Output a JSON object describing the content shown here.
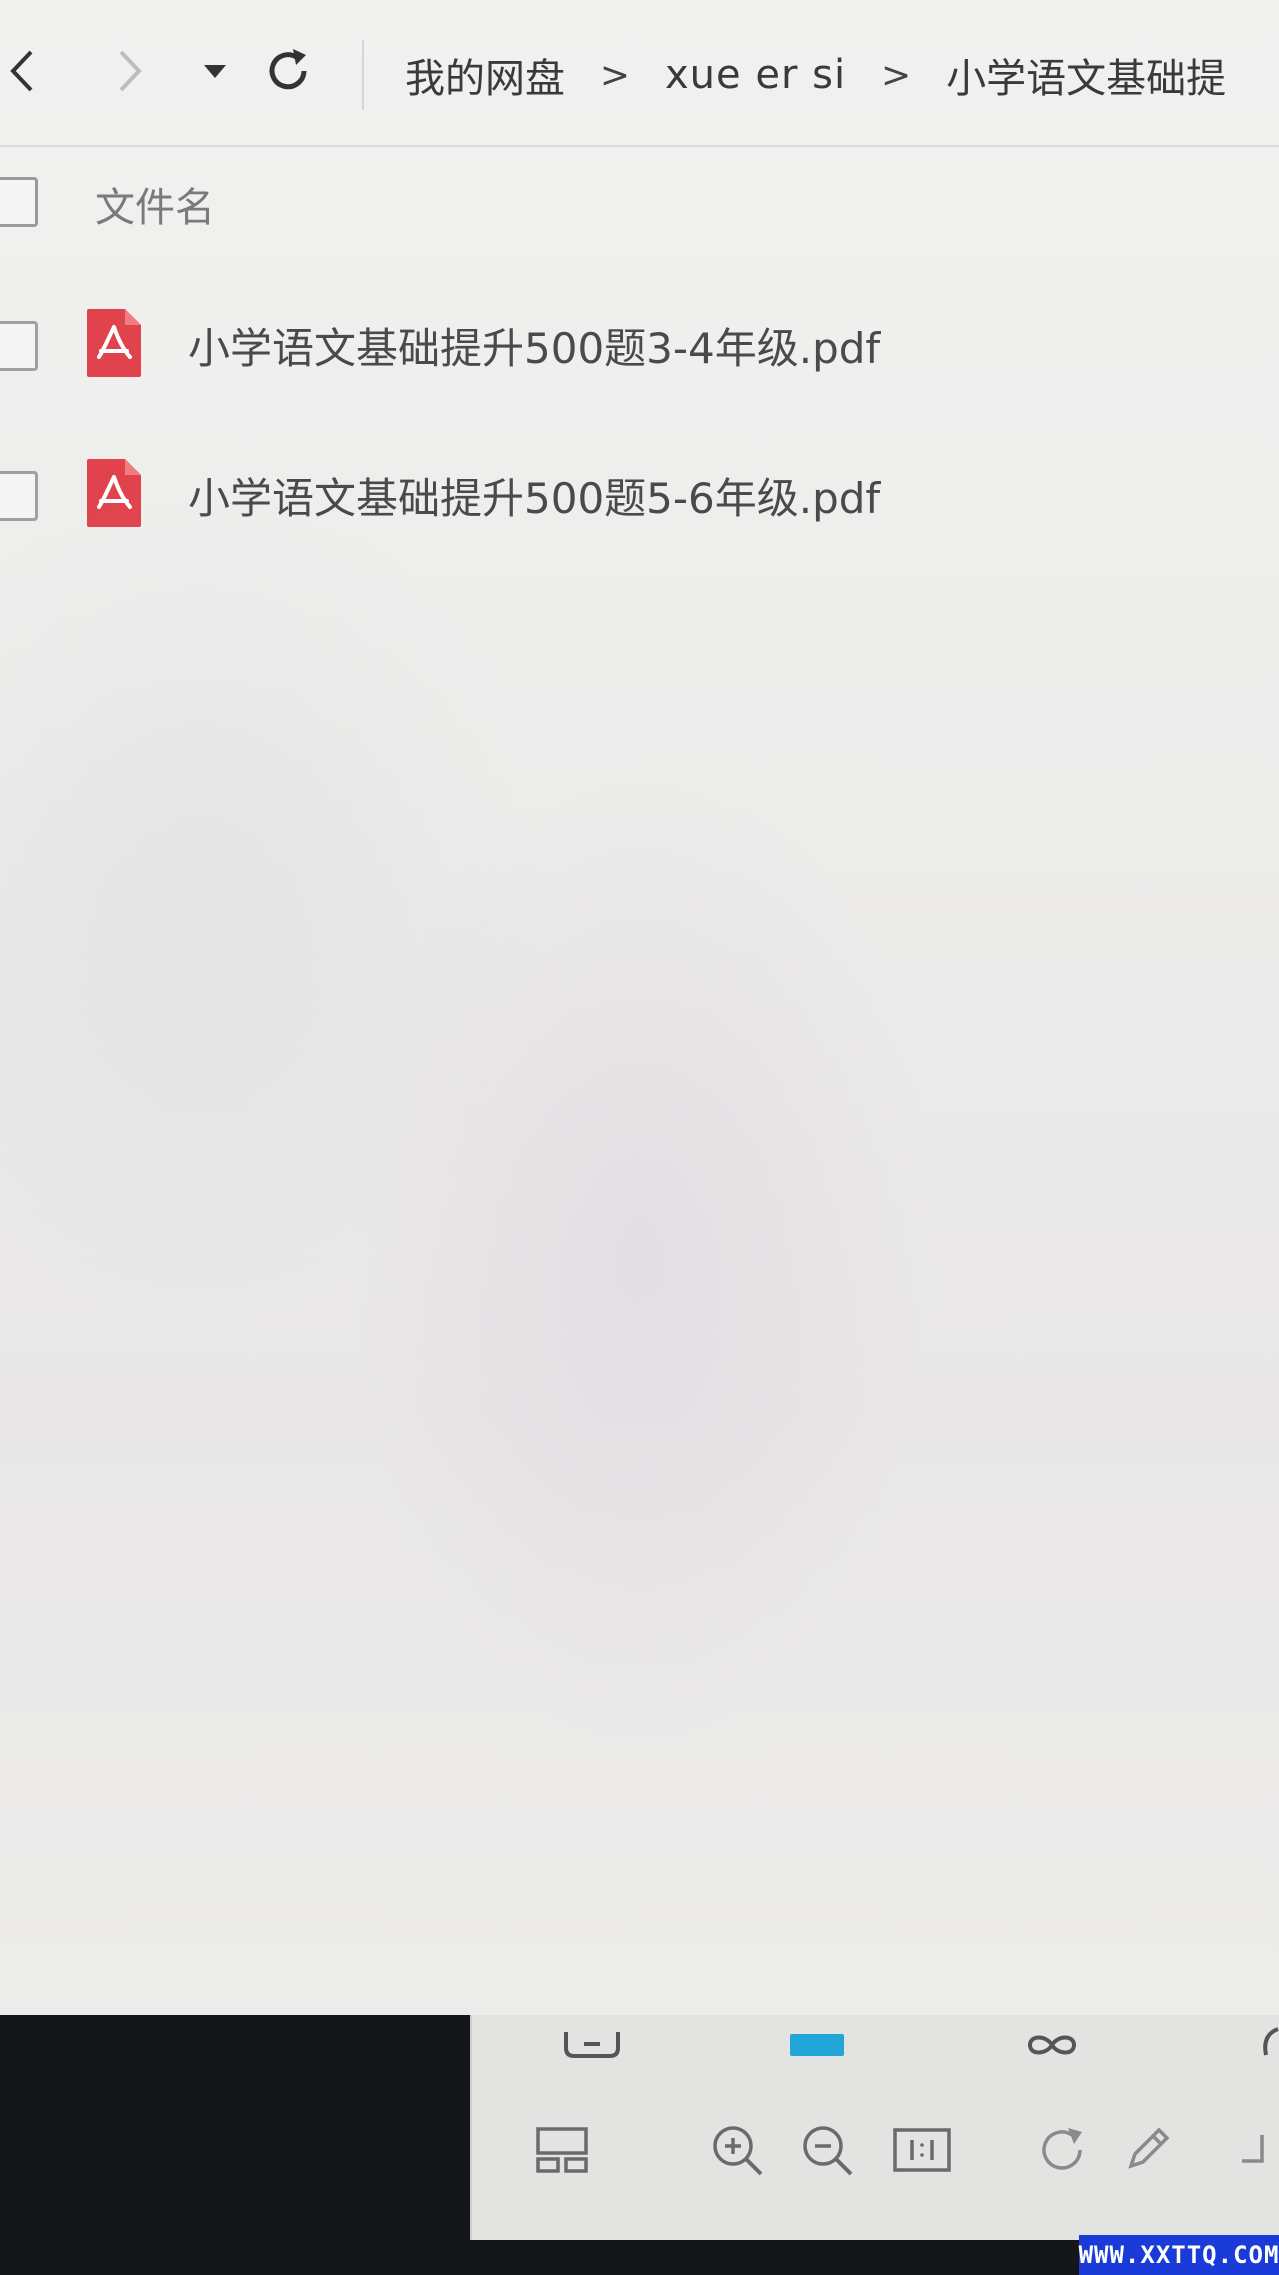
{
  "toolbar": {
    "back_icon": "chevron-left-icon",
    "forward_icon": "chevron-right-icon",
    "dropdown_icon": "caret-down-icon",
    "refresh_icon": "refresh-icon"
  },
  "breadcrumb": {
    "items": [
      "我的网盘",
      "xue er si",
      "小学语文基础提"
    ],
    "separator": ">"
  },
  "file_list": {
    "header_label": "文件名",
    "files": [
      {
        "name": "小学语文基础提升500题3-4年级.pdf",
        "icon": "pdf-icon"
      },
      {
        "name": "小学语文基础提升500题5-6年级.pdf",
        "icon": "pdf-icon"
      }
    ]
  },
  "viewer_toolbar": {
    "tools": [
      "layout-icon",
      "zoom-in-icon",
      "zoom-out-icon",
      "actual-size-icon",
      "rotate-icon",
      "edit-icon",
      "more-icon"
    ]
  },
  "watermark": {
    "text": "WWW.XXTTQ.COM"
  },
  "colors": {
    "pdf_red": "#e0434b",
    "accent_blue": "#22a6d8",
    "watermark_blue": "#1b3bd8"
  }
}
